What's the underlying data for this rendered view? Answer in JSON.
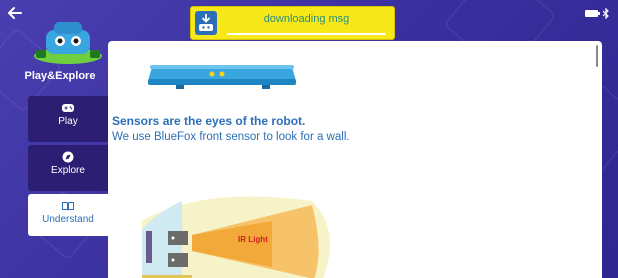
{
  "header": {
    "back_icon": "arrow-left-icon",
    "status_icons": [
      "battery-icon",
      "bluetooth-icon"
    ]
  },
  "download": {
    "message": "downloading msg",
    "icon": "robot-download-icon",
    "progress": 1.0
  },
  "sidebar": {
    "title": "Play&Explore",
    "items": [
      {
        "label": "Play",
        "icon": "gamepad-icon",
        "active": false
      },
      {
        "label": "Explore",
        "icon": "compass-icon",
        "active": false
      },
      {
        "label": "Understand",
        "icon": "book-icon",
        "active": true
      }
    ]
  },
  "content": {
    "heading": "Sensors are the eyes of the robot.",
    "text": "We use BlueFox front sensor to look for a wall.",
    "diagram_label": "IR Light"
  },
  "colors": {
    "background": "#3a2f9e",
    "sidebar_item": "#2c1f73",
    "accent": "#2c6fb8",
    "banner": "#f7e81a",
    "ir_text": "#cc1f1f"
  }
}
